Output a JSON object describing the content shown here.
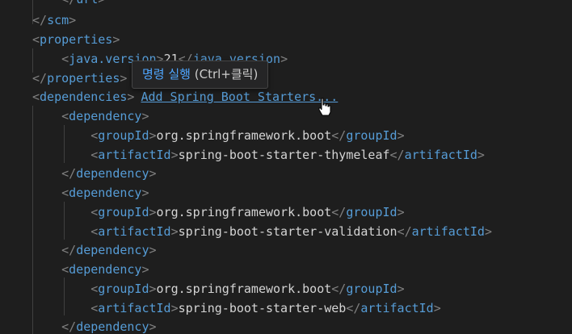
{
  "lines": [
    {
      "type": "close",
      "tag": "url",
      "clipped": true
    },
    {
      "type": "close",
      "tag": "scm"
    },
    {
      "type": "open",
      "tag": "properties"
    },
    {
      "type": "element",
      "tag": "java.version",
      "value": "21"
    },
    {
      "type": "close",
      "tag": "properties"
    },
    {
      "type": "open",
      "tag": "dependencies"
    },
    {
      "type": "open",
      "tag": "dependency"
    },
    {
      "type": "element",
      "tag": "groupId",
      "value": "org.springframework.boot"
    },
    {
      "type": "element",
      "tag": "artifactId",
      "value": "spring-boot-starter-thymeleaf"
    },
    {
      "type": "close",
      "tag": "dependency"
    },
    {
      "type": "open",
      "tag": "dependency"
    },
    {
      "type": "element",
      "tag": "groupId",
      "value": "org.springframework.boot"
    },
    {
      "type": "element",
      "tag": "artifactId",
      "value": "spring-boot-starter-validation"
    },
    {
      "type": "close",
      "tag": "dependency"
    },
    {
      "type": "open",
      "tag": "dependency"
    },
    {
      "type": "element",
      "tag": "groupId",
      "value": "org.springframework.boot"
    },
    {
      "type": "element",
      "tag": "artifactId",
      "value": "spring-boot-starter-web"
    },
    {
      "type": "close",
      "tag": "dependency"
    }
  ],
  "codelens": {
    "label": "Add Spring Boot Starters..."
  },
  "tooltip": {
    "command": "명령 실행",
    "shortcut": "(Ctrl+클릭)"
  },
  "colors": {
    "background": "#1e1e1e",
    "tag": "#569cd6",
    "bracket": "#808080",
    "text": "#d4d4d4",
    "link": "#569cd6"
  },
  "icons": {
    "cursor": "hand-pointer-icon"
  }
}
